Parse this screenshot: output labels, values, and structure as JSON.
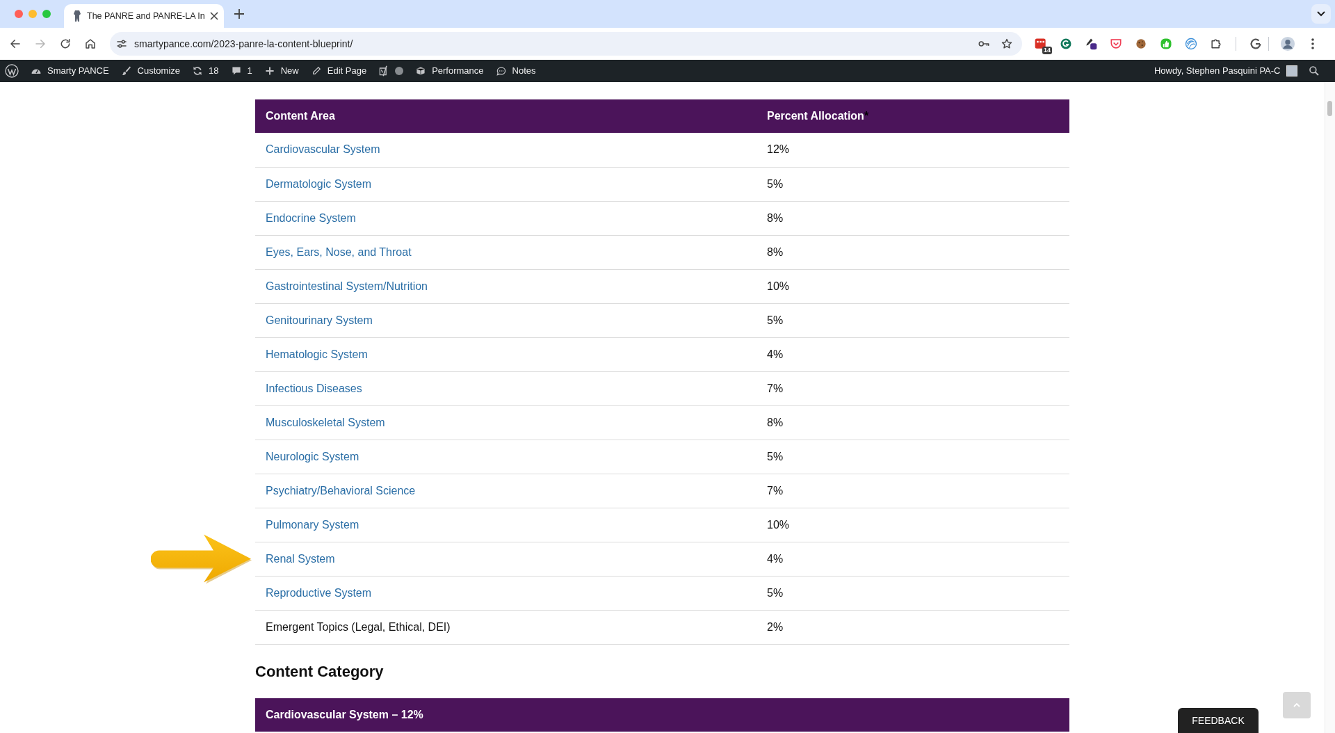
{
  "browser": {
    "tabs": [
      {
        "title": "The PANRE and PANRE-LA In",
        "selected": true
      }
    ],
    "url": "smartypance.com/2023-panre-la-content-blueprint/",
    "extension_badge": "14"
  },
  "admin_bar": {
    "items": [
      {
        "kind": "site",
        "label": "Smarty PANCE"
      },
      {
        "kind": "customize",
        "label": "Customize"
      },
      {
        "kind": "updates",
        "label": "18"
      },
      {
        "kind": "comments",
        "label": "1"
      },
      {
        "kind": "new",
        "label": "New"
      },
      {
        "kind": "edit",
        "label": "Edit Page"
      },
      {
        "kind": "seo"
      },
      {
        "kind": "performance",
        "label": "Performance"
      },
      {
        "kind": "notes",
        "label": "Notes"
      }
    ],
    "greeting": "Howdy, Stephen Pasquini PA-C"
  },
  "blueprint_table": {
    "columns": [
      {
        "label": "Content Area"
      },
      {
        "label": "Percent Allocation",
        "note_mark": "*"
      }
    ],
    "rows": [
      {
        "area": "Cardiovascular System",
        "link": true,
        "percent": "12%",
        "marked": false
      },
      {
        "area": "Dermatologic System",
        "link": true,
        "percent": "5%",
        "marked": false
      },
      {
        "area": "Endocrine System",
        "link": true,
        "percent": "8%",
        "marked": false
      },
      {
        "area": "Eyes, Ears, Nose, and Throat",
        "link": true,
        "percent": "8%",
        "marked": false
      },
      {
        "area": "Gastrointestinal System/Nutrition",
        "link": true,
        "percent": "10%",
        "marked": false
      },
      {
        "area": "Genitourinary System",
        "link": true,
        "percent": "5%",
        "marked": false
      },
      {
        "area": "Hematologic System",
        "link": true,
        "percent": "4%",
        "marked": false
      },
      {
        "area": "Infectious Diseases",
        "link": true,
        "percent": "7%",
        "marked": false
      },
      {
        "area": "Musculoskeletal System",
        "link": true,
        "percent": "8%",
        "marked": false
      },
      {
        "area": "Neurologic System",
        "link": true,
        "percent": "5%",
        "marked": false
      },
      {
        "area": "Psychiatry/Behavioral Science",
        "link": true,
        "percent": "7%",
        "marked": false
      },
      {
        "area": "Pulmonary System",
        "link": true,
        "percent": "10%",
        "marked": false
      },
      {
        "area": "Renal System",
        "link": true,
        "percent": "4%",
        "marked": true
      },
      {
        "area": "Reproductive System",
        "link": true,
        "percent": "5%",
        "marked": false
      },
      {
        "area": "Emergent Topics (Legal, Ethical, DEI)",
        "link": false,
        "percent": "2%",
        "marked": false
      }
    ]
  },
  "section_heading": "Content Category",
  "category_table": {
    "header": "Cardiovascular System – 12%"
  },
  "feedback_button": "FEEDBACK"
}
